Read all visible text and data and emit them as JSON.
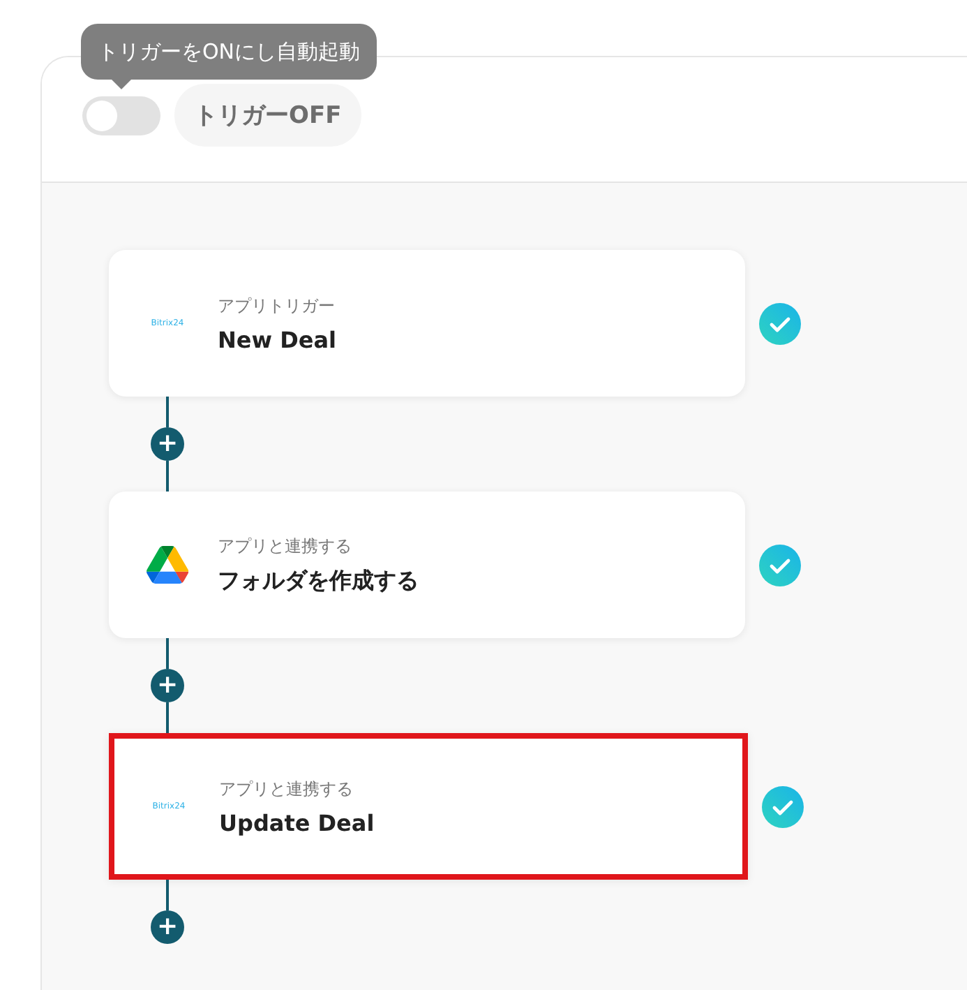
{
  "tooltip": "トリガーをONにし自動起動",
  "trigger": {
    "on": false,
    "label": "トリガーOFF"
  },
  "steps": [
    {
      "kind": "bitrix",
      "logo": "Bitrix24",
      "caption": "アプリトリガー",
      "title": "New Deal",
      "done": true,
      "highlighted": false
    },
    {
      "kind": "drive",
      "caption": "アプリと連携する",
      "title": "フォルダを作成する",
      "done": true,
      "highlighted": false
    },
    {
      "kind": "bitrix",
      "logo": "Bitrix24",
      "caption": "アプリと連携する",
      "title": "Update Deal",
      "done": true,
      "highlighted": true
    }
  ],
  "add_symbol": "+"
}
